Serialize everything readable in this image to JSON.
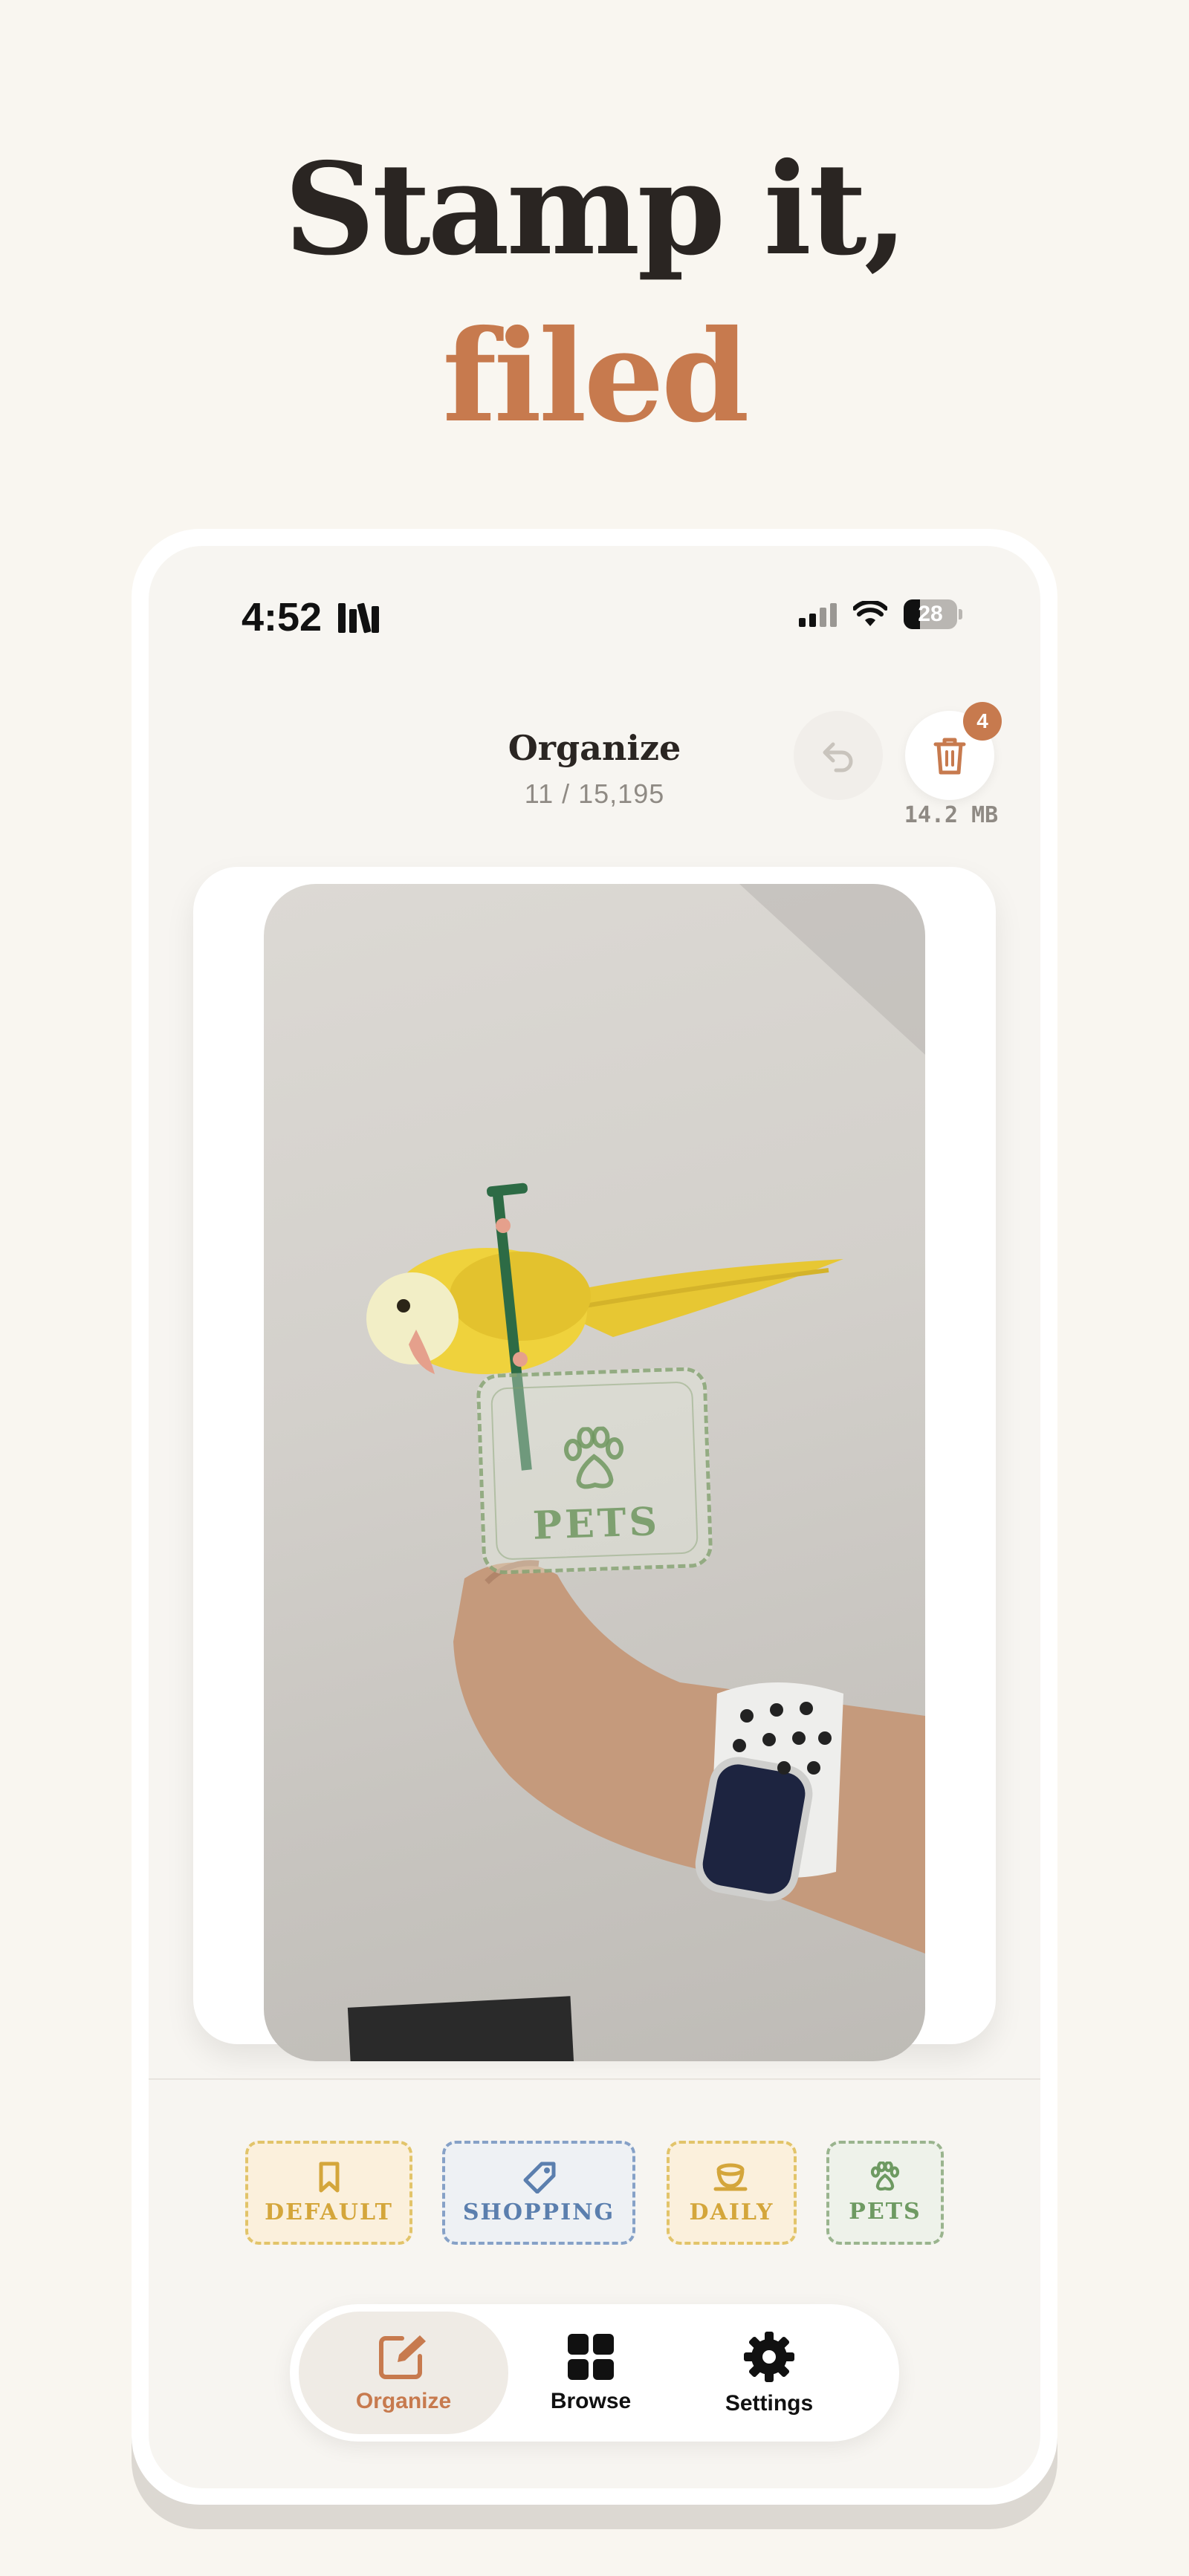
{
  "headline": {
    "line1": "Stamp it,",
    "line2": "filed"
  },
  "status_bar": {
    "time": "4:52",
    "battery": "28"
  },
  "header": {
    "title": "Organize",
    "count": "11 / 15,195",
    "trash_badge": "4",
    "trash_size": "14.2 MB"
  },
  "photo": {
    "stamp_label": "PETS",
    "stamp_icon": "paw-icon"
  },
  "tags": [
    {
      "label": "DEFAULT",
      "icon": "bookmark-icon",
      "color": "#d4a63b"
    },
    {
      "label": "SHOPPING",
      "icon": "price-tag-icon",
      "color": "#5b7fae"
    },
    {
      "label": "DAILY",
      "icon": "coffee-cup-icon",
      "color": "#d4a63b"
    },
    {
      "label": "PETS",
      "icon": "paw-icon",
      "color": "#6e9a62"
    }
  ],
  "tabs": [
    {
      "label": "Organize",
      "icon": "edit-icon",
      "active": true
    },
    {
      "label": "Browse",
      "icon": "grid-icon",
      "active": false
    },
    {
      "label": "Settings",
      "icon": "gear-icon",
      "active": false
    }
  ],
  "colors": {
    "accent": "#c77a4e",
    "background": "#f9f6f0",
    "text": "#2a2522"
  }
}
